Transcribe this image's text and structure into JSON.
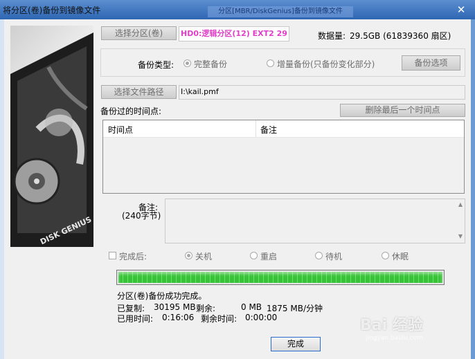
{
  "window": {
    "title": "将分区(卷)备份到镜像文件",
    "faded_title": "分区[MBR/DiskGenius]备份到镜像文件",
    "close_glyph": "✕"
  },
  "partition": {
    "button_label": "选择分区(卷)",
    "value": "HD0:逻辑分区(12) EXT2 29",
    "data_size_label": "数据量:",
    "data_size": "29.5GB (61839360 扇区)"
  },
  "backup_type": {
    "label": "备份类型:",
    "options": [
      {
        "label": "完整备份",
        "selected": true
      },
      {
        "label": "增量备份(只备份变化部分)",
        "selected": false
      }
    ],
    "options_button": "备份选项"
  },
  "file": {
    "button_label": "选择文件路径",
    "value": "I:\\kail.pmf"
  },
  "timepoints": {
    "label": "备份过的时间点:",
    "delete_button": "删除最后一个时间点",
    "columns": [
      "时间点",
      "备注"
    ],
    "rows": []
  },
  "notes": {
    "label": "备注:",
    "sublabel": "(240字节)",
    "value": ""
  },
  "after_completion": {
    "label": "完成后:",
    "checked": false,
    "options": [
      {
        "label": "关机",
        "selected": true
      },
      {
        "label": "重启",
        "selected": false
      },
      {
        "label": "待机",
        "selected": false
      },
      {
        "label": "休眠",
        "selected": false
      }
    ]
  },
  "progress": {
    "fraction": 1.0,
    "status": "分区(卷)备份成功完成。",
    "copied_label": "已复制:",
    "copied_value": "30195 MB",
    "remaining_label": "剩余:",
    "remaining_value": "0 MB",
    "speed": "1875 MB/分钟",
    "elapsed_label": "已用时间:",
    "elapsed_value": "0:16:06",
    "time_left_label": "剩余时间:",
    "time_left_value": "0:00:00"
  },
  "finish_button": "完成",
  "watermark": {
    "brand": "Bai 经验",
    "url": "jingyan.baidu.com"
  },
  "hdd_image_text": "DISK GENIUS",
  "colors": {
    "accent": "#2a6bd0",
    "progress": "#37c337",
    "partition_text": "#e03ec8"
  }
}
